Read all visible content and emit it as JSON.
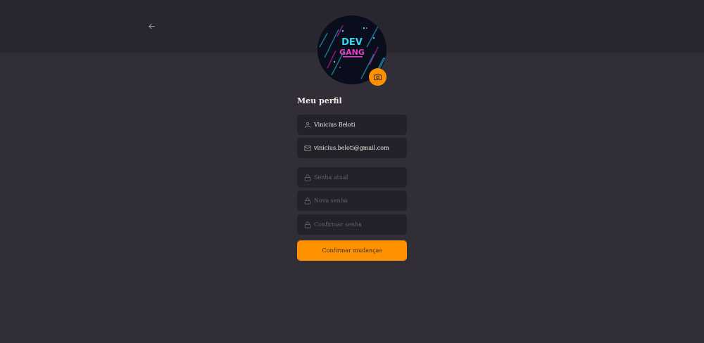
{
  "header": {
    "back_icon": "arrow-left-icon"
  },
  "avatar": {
    "logo_text_line1": "DEV",
    "logo_text_line2": "GANG",
    "camera_icon": "camera-icon"
  },
  "profile": {
    "title": "Meu perfil",
    "name_value": "Vinicius Beloti",
    "email_value": "vinicius.beloti@gmail.com",
    "old_password_placeholder": "Senha atual",
    "new_password_placeholder": "Nova senha",
    "confirm_password_placeholder": "Confirmar senha",
    "submit_label": "Confirmar mudanças"
  },
  "colors": {
    "background": "#312e38",
    "header": "#28262e",
    "input_bg": "#232129",
    "accent": "#ff9000",
    "text": "#f4ede8",
    "placeholder": "#666360"
  }
}
